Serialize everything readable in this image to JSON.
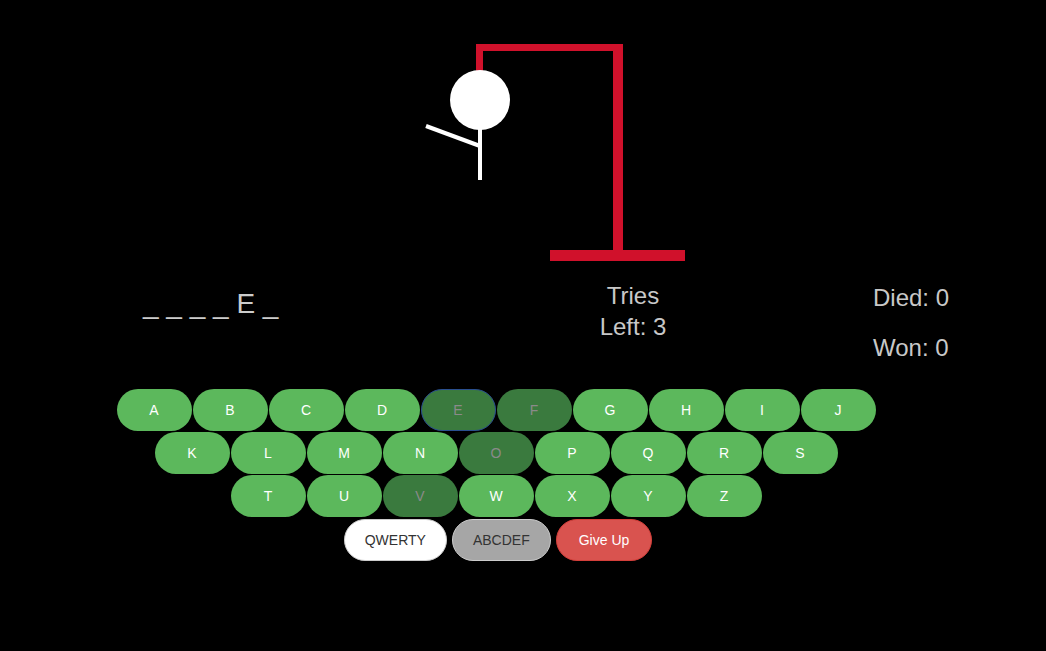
{
  "hangman": {
    "parts": [
      {
        "name": "head",
        "shown": true
      },
      {
        "name": "body",
        "shown": true
      },
      {
        "name": "left-arm",
        "shown": true
      },
      {
        "name": "right-arm",
        "shown": false
      },
      {
        "name": "left-leg",
        "shown": false
      },
      {
        "name": "right-leg",
        "shown": false
      }
    ]
  },
  "word": "_ _ _ _ E _",
  "tries": {
    "label": "Tries Left:",
    "value": "3"
  },
  "stats": [
    {
      "label": "Died:",
      "value": "0"
    },
    {
      "label": "Won:",
      "value": "0"
    }
  ],
  "keyboard": [
    [
      {
        "label": "A",
        "used": false,
        "focused": false
      },
      {
        "label": "B",
        "used": false,
        "focused": false
      },
      {
        "label": "C",
        "used": false,
        "focused": false
      },
      {
        "label": "D",
        "used": false,
        "focused": false
      },
      {
        "label": "E",
        "used": true,
        "focused": true
      },
      {
        "label": "F",
        "used": true,
        "focused": false
      },
      {
        "label": "G",
        "used": false,
        "focused": false
      },
      {
        "label": "H",
        "used": false,
        "focused": false
      },
      {
        "label": "I",
        "used": false,
        "focused": false
      },
      {
        "label": "J",
        "used": false,
        "focused": false
      }
    ],
    [
      {
        "label": "K",
        "used": false,
        "focused": false
      },
      {
        "label": "L",
        "used": false,
        "focused": false
      },
      {
        "label": "M",
        "used": false,
        "focused": false
      },
      {
        "label": "N",
        "used": false,
        "focused": false
      },
      {
        "label": "O",
        "used": true,
        "focused": false
      },
      {
        "label": "P",
        "used": false,
        "focused": false
      },
      {
        "label": "Q",
        "used": false,
        "focused": false
      },
      {
        "label": "R",
        "used": false,
        "focused": false
      },
      {
        "label": "S",
        "used": false,
        "focused": false
      }
    ],
    [
      {
        "label": "T",
        "used": false,
        "focused": false
      },
      {
        "label": "U",
        "used": false,
        "focused": false
      },
      {
        "label": "V",
        "used": true,
        "focused": false
      },
      {
        "label": "W",
        "used": false,
        "focused": false
      },
      {
        "label": "X",
        "used": false,
        "focused": false
      },
      {
        "label": "Y",
        "used": false,
        "focused": false
      },
      {
        "label": "Z",
        "used": false,
        "focused": false
      }
    ]
  ],
  "layout_buttons": [
    {
      "label": "QWERTY",
      "selected": false
    },
    {
      "label": "ABCDEF",
      "selected": true
    }
  ],
  "give_up": {
    "label": "Give Up"
  }
}
